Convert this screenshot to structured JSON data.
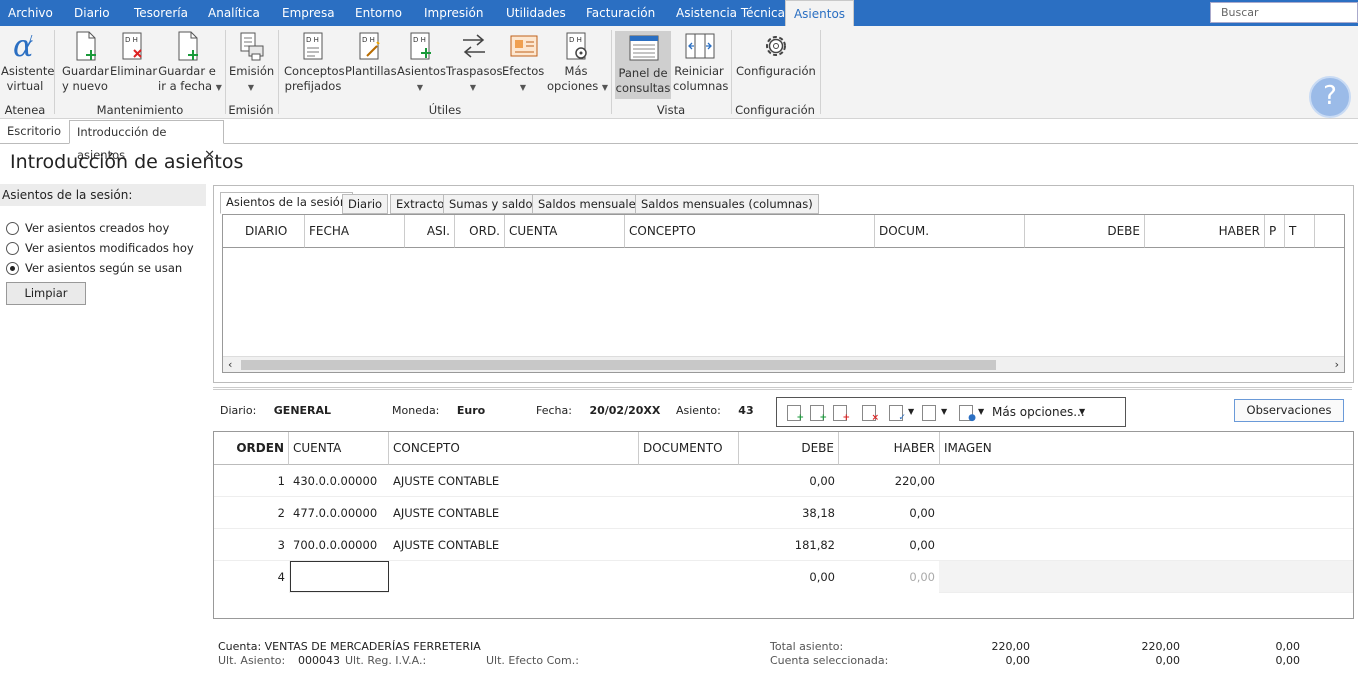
{
  "menu": {
    "items": [
      "Archivo",
      "Diario",
      "Tesorería",
      "Analítica",
      "Empresa",
      "Entorno",
      "Impresión",
      "Utilidades",
      "Facturación",
      "Asistencia Técnica",
      "Asientos"
    ],
    "search_placeholder": "Buscar"
  },
  "ribbon": {
    "asistente": [
      "Asistente",
      "virtual"
    ],
    "guardar_nuevo": [
      "Guardar",
      "y nuevo"
    ],
    "eliminar": "Eliminar",
    "guardar_fecha": [
      "Guardar e",
      "ir a fecha"
    ],
    "emision": "Emisión",
    "conceptos": [
      "Conceptos",
      "prefijados"
    ],
    "plantillas": "Plantillas",
    "asientos": "Asientos",
    "traspasos": "Traspasos",
    "efectos": "Efectos",
    "mas_opciones": [
      "Más",
      "opciones"
    ],
    "panel": [
      "Panel de",
      "consultas"
    ],
    "reiniciar": [
      "Reiniciar",
      "columnas"
    ],
    "configuracion": "Configuración",
    "groups": {
      "atenea": "Atenea",
      "mantenimiento": "Mantenimiento",
      "emision": "Emisión",
      "utiles": "Útiles",
      "vista": "Vista",
      "configuracion": "Configuración"
    },
    "help_glyph": "?"
  },
  "doc_tabs": [
    "Escritorio",
    "Introducción de asientos"
  ],
  "page_title": "Introducción de asientos",
  "left": {
    "header": "Asientos de la sesión:",
    "radios": [
      "Ver asientos creados hoy",
      "Ver asientos modificados hoy",
      "Ver asientos según se usan"
    ],
    "selected_index": 2,
    "clear_button": "Limpiar"
  },
  "session": {
    "tabs": [
      "Asientos de la sesión",
      "Diario",
      "Extracto",
      "Sumas y saldos",
      "Saldos mensuales",
      "Saldos mensuales (columnas)"
    ],
    "columns": [
      "DIARIO",
      "FECHA",
      "ASI.",
      "ORD.",
      "CUENTA",
      "CONCEPTO",
      "DOCUM.",
      "DEBE",
      "HABER",
      "P",
      "T"
    ]
  },
  "entry": {
    "diario_label": "Diario:",
    "diario": "GENERAL",
    "moneda_label": "Moneda:",
    "moneda": "Euro",
    "fecha_label": "Fecha:",
    "fecha": "20/02/20XX",
    "asiento_label": "Asiento:",
    "asiento": "43",
    "mas_opciones": "Más opciones...",
    "observaciones": "Observaciones",
    "columns": [
      "ORDEN",
      "CUENTA",
      "CONCEPTO",
      "DOCUMENTO",
      "DEBE",
      "HABER",
      "IMAGEN"
    ],
    "rows": [
      {
        "orden": "1",
        "cuenta": "430.0.0.00000",
        "concepto": "AJUSTE CONTABLE",
        "documento": "",
        "debe": "0,00",
        "haber": "220,00"
      },
      {
        "orden": "2",
        "cuenta": "477.0.0.00000",
        "concepto": "AJUSTE CONTABLE",
        "documento": "",
        "debe": "38,18",
        "haber": "0,00"
      },
      {
        "orden": "3",
        "cuenta": "700.0.0.00000",
        "concepto": "AJUSTE CONTABLE",
        "documento": "",
        "debe": "181,82",
        "haber": "0,00"
      },
      {
        "orden": "4",
        "cuenta": "",
        "concepto": "",
        "documento": "",
        "debe": "0,00",
        "haber": "0,00"
      }
    ]
  },
  "footer": {
    "cuenta_label": "Cuenta:",
    "cuenta": "VENTAS DE MERCADERÍAS FERRETERIA",
    "ult_asiento_label": "Ult. Asiento:",
    "ult_asiento": "000043",
    "ult_reg_label": "Ult. Reg. I.V.A.:",
    "ult_efecto_label": "Ult. Efecto Com.:",
    "total_label": "Total asiento:",
    "total_debe": "220,00",
    "total_haber": "220,00",
    "total_saldo": "0,00",
    "sel_label": "Cuenta seleccionada:",
    "sel_debe": "0,00",
    "sel_haber": "0,00",
    "sel_saldo": "0,00"
  }
}
